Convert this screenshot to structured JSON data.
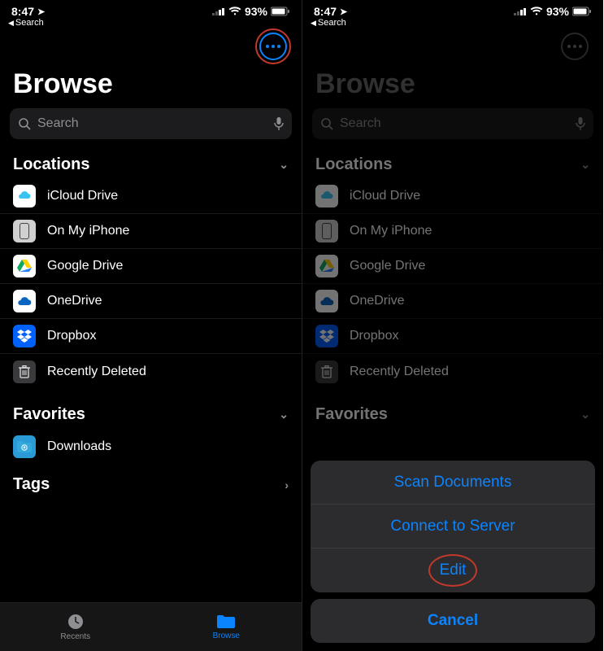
{
  "status": {
    "time": "8:47",
    "battery": "93%",
    "back_label": "Search"
  },
  "more_button": {
    "name": "more"
  },
  "title": "Browse",
  "search": {
    "placeholder": "Search"
  },
  "sections": {
    "locations": {
      "header": "Locations",
      "items": [
        {
          "label": "iCloud Drive",
          "icon": "icloud"
        },
        {
          "label": "On My iPhone",
          "icon": "phone"
        },
        {
          "label": "Google Drive",
          "icon": "gdrive"
        },
        {
          "label": "OneDrive",
          "icon": "onedrive"
        },
        {
          "label": "Dropbox",
          "icon": "dropbox"
        },
        {
          "label": "Recently Deleted",
          "icon": "trash"
        }
      ]
    },
    "favorites": {
      "header": "Favorites",
      "items": [
        {
          "label": "Downloads",
          "icon": "folder"
        }
      ]
    },
    "tags": {
      "header": "Tags"
    }
  },
  "tabbar": {
    "items": [
      {
        "label": "Recents",
        "icon": "clock",
        "active": false
      },
      {
        "label": "Browse",
        "icon": "folder",
        "active": true
      }
    ]
  },
  "action_sheet": {
    "items": [
      {
        "label": "Scan Documents"
      },
      {
        "label": "Connect to Server"
      },
      {
        "label": "Edit"
      }
    ],
    "cancel": "Cancel"
  },
  "annotations": {
    "highlight_more_button": true,
    "highlight_edit": true
  }
}
